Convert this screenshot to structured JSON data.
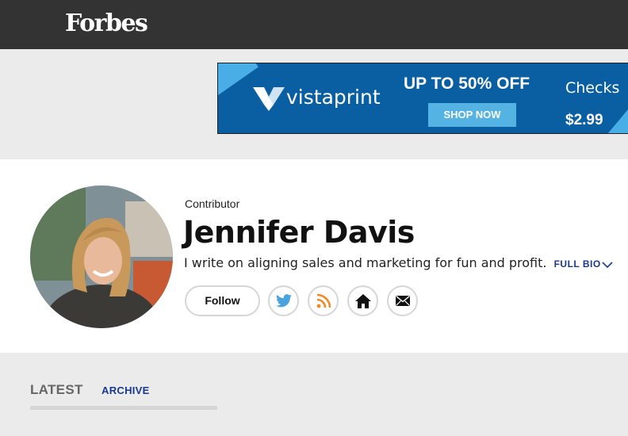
{
  "header": {
    "logo": "Forbes"
  },
  "ad": {
    "brand": "vistaprint",
    "headline": "UP TO 50% OFF",
    "cta": "SHOP NOW",
    "product": "Checks",
    "price": "$2.99",
    "colors": {
      "background": "#0a5fa3",
      "accent": "#49aee6",
      "button": "#55b3e4"
    }
  },
  "profile": {
    "role": "Contributor",
    "name": "Jennifer Davis",
    "bio": "I write on aligning sales and marketing for fun and profit.",
    "full_bio_label": "FULL BIO",
    "follow_label": "Follow",
    "social_icons": [
      "twitter-icon",
      "rss-icon",
      "home-icon",
      "mail-icon"
    ]
  },
  "tabs": {
    "latest": "LATEST",
    "archive": "ARCHIVE"
  },
  "colors": {
    "topbar": "#333333",
    "link": "#18398d",
    "page_bg": "#ebebeb"
  }
}
